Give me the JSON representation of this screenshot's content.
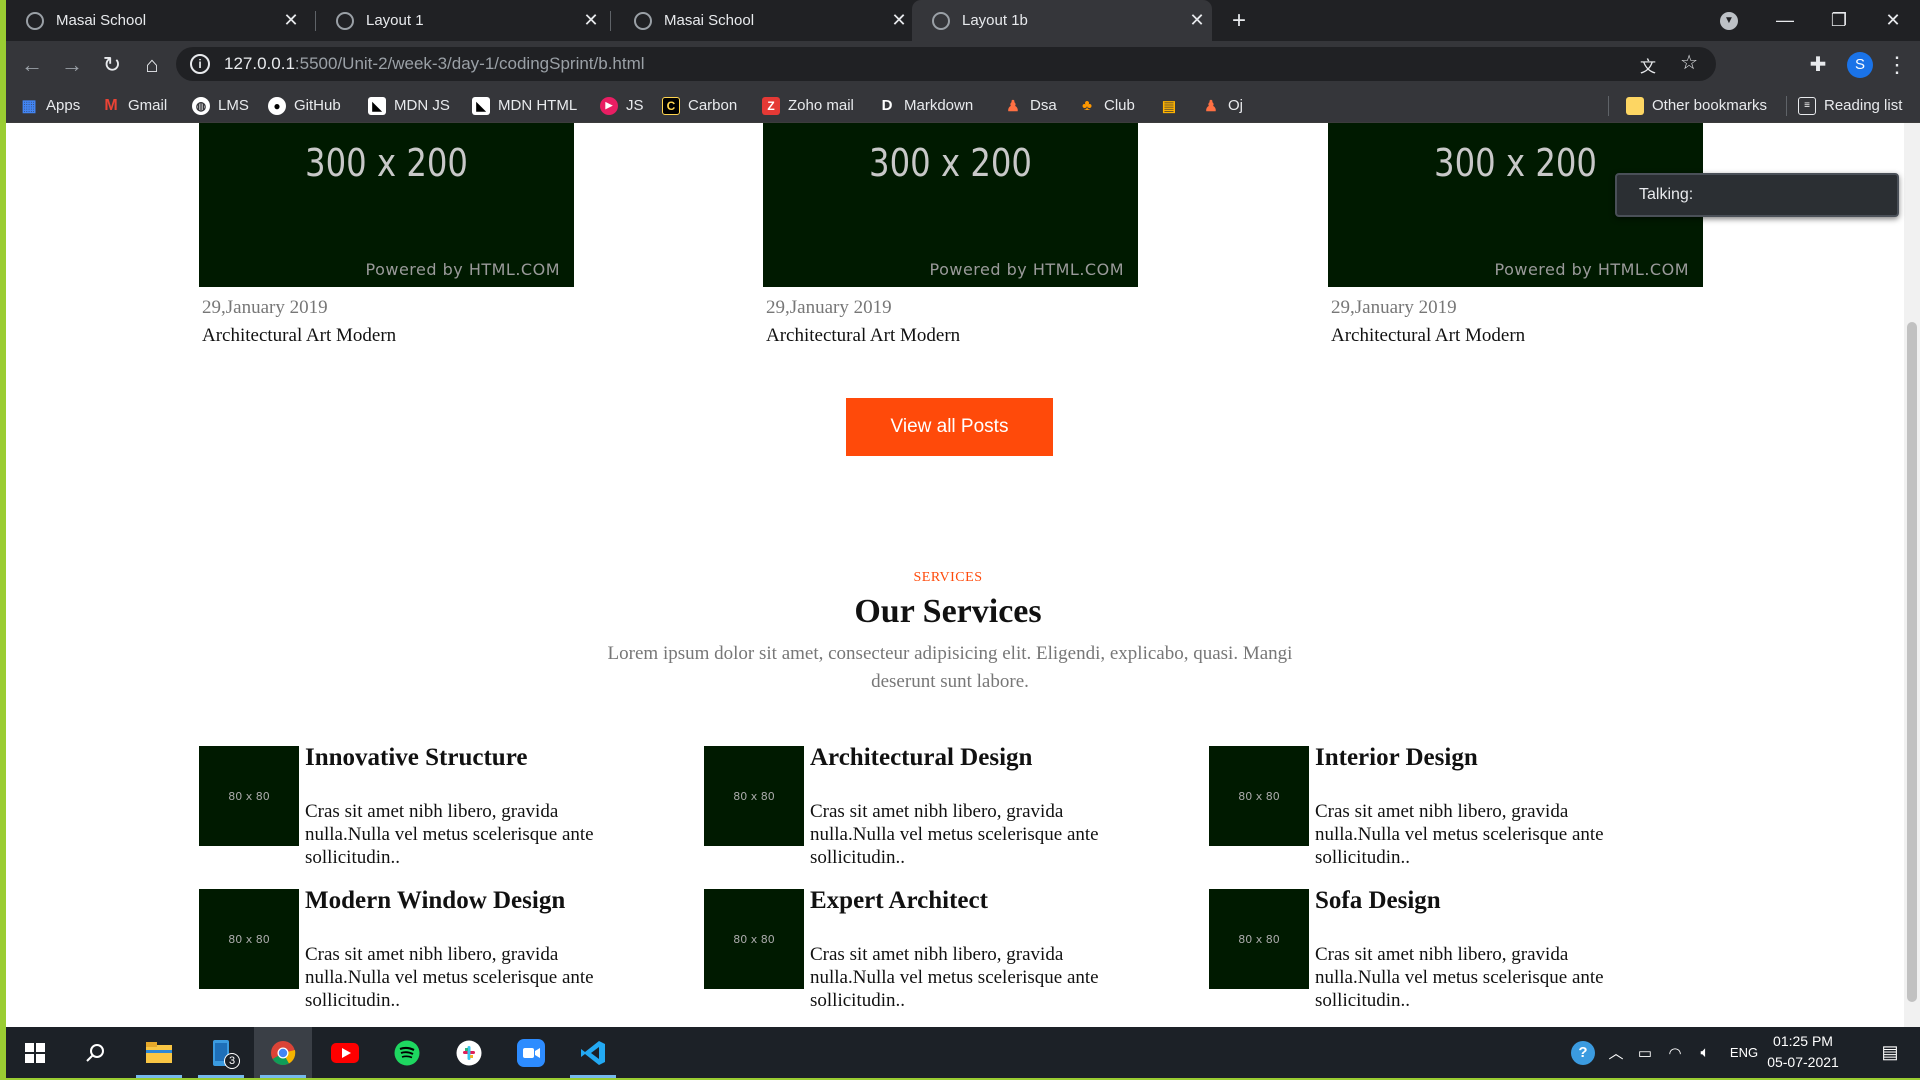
{
  "browser": {
    "tabs": [
      {
        "title": "Masai School",
        "active": false
      },
      {
        "title": "Layout 1",
        "active": false
      },
      {
        "title": "Masai School",
        "active": false
      },
      {
        "title": "Layout 1b",
        "active": true
      }
    ],
    "new_tab_symbol": "+",
    "url_host": "127.0.0.1",
    "url_path": ":5500/Unit-2/week-3/day-1/codingSprint/b.html",
    "profile_initial": "S",
    "bookmarks": [
      {
        "label": "Apps",
        "icon": "apps-grid-icon"
      },
      {
        "label": "Gmail",
        "icon": "gmail-icon"
      },
      {
        "label": "LMS",
        "icon": "globe-icon"
      },
      {
        "label": "GitHub",
        "icon": "github-icon"
      },
      {
        "label": "MDN JS",
        "icon": "mdn-icon"
      },
      {
        "label": "MDN HTML",
        "icon": "mdn-icon"
      },
      {
        "label": "JS",
        "icon": "play-icon"
      },
      {
        "label": "Carbon",
        "icon": "carbon-icon"
      },
      {
        "label": "Zoho mail",
        "icon": "zoho-icon"
      },
      {
        "label": "Markdown",
        "icon": "markdown-icon"
      },
      {
        "label": "Dsa",
        "icon": "dsa-icon"
      },
      {
        "label": "Club",
        "icon": "club-icon"
      },
      {
        "label": "",
        "icon": "bus-icon"
      },
      {
        "label": "Oj",
        "icon": "oj-icon"
      }
    ],
    "other_bookmarks": "Other bookmarks",
    "reading_list": "Reading list"
  },
  "posts": [
    {
      "image_text": "300 x 200",
      "powered": "Powered by HTML.COM",
      "date": "29,January 2019",
      "title": "Architectural Art Modern"
    },
    {
      "image_text": "300 x 200",
      "powered": "Powered by HTML.COM",
      "date": "29,January 2019",
      "title": "Architectural Art Modern"
    },
    {
      "image_text": "300 x 200",
      "powered": "Powered by HTML.COM",
      "date": "29,January 2019",
      "title": "Architectural Art Modern"
    }
  ],
  "view_all_label": "View all Posts",
  "services": {
    "label": "SERVICES",
    "title": "Our Services",
    "description": "Lorem ipsum dolor sit amet, consecteur adipisicing elit. Eligendi, explicabo, quasi. Mangi deserunt sunt labore.",
    "items": [
      {
        "thumb": "80 x 80",
        "title": "Innovative Structure",
        "text": "Cras sit amet nibh libero, gravida nulla.Nulla vel metus scelerisque ante sollicitudin.."
      },
      {
        "thumb": "80 x 80",
        "title": "Architectural Design",
        "text": "Cras sit amet nibh libero, gravida nulla.Nulla vel metus scelerisque ante sollicitudin.."
      },
      {
        "thumb": "80 x 80",
        "title": "Interior Design",
        "text": "Cras sit amet nibh libero, gravida nulla.Nulla vel metus scelerisque ante sollicitudin.."
      },
      {
        "thumb": "80 x 80",
        "title": "Modern Window Design",
        "text": "Cras sit amet nibh libero, gravida nulla.Nulla vel metus scelerisque ante sollicitudin.."
      },
      {
        "thumb": "80 x 80",
        "title": "Expert Architect",
        "text": "Cras sit amet nibh libero, gravida nulla.Nulla vel metus scelerisque ante sollicitudin.."
      },
      {
        "thumb": "80 x 80",
        "title": "Sofa Design",
        "text": "Cras sit amet nibh libero, gravida nulla.Nulla vel metus scelerisque ante sollicitudin.."
      }
    ]
  },
  "popup": {
    "text": "Talking:"
  },
  "taskbar": {
    "apps": [
      "windows-start-icon",
      "search-icon",
      "file-explorer-icon",
      "phone-icon",
      "chrome-icon",
      "youtube-icon",
      "spotify-icon",
      "slack-icon",
      "zoom-icon",
      "vscode-icon"
    ],
    "phone_badge": "3",
    "language": "ENG",
    "time": "01:25 PM",
    "date": "05-07-2021"
  },
  "colors": {
    "accent": "#ff4a0a",
    "frame": "#9acd32",
    "placeholder": "#001a00"
  }
}
